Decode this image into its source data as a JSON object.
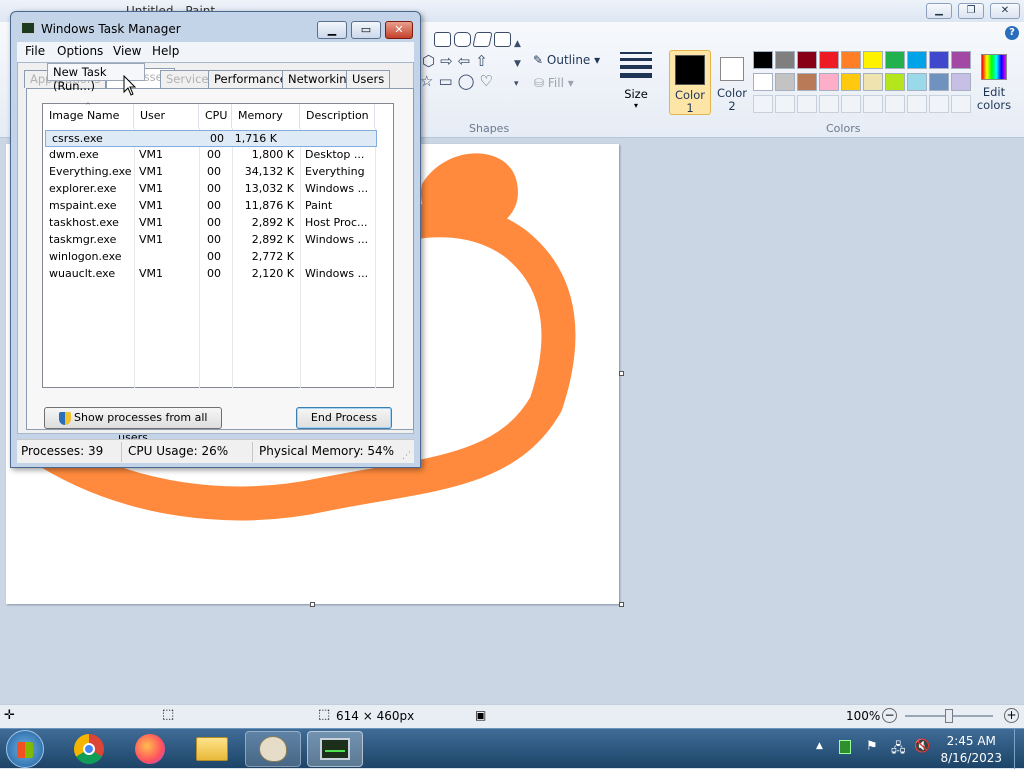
{
  "paint": {
    "title": "Untitled - Paint",
    "ribbon": {
      "outline_label": "Outline",
      "fill_label": "Fill",
      "size_label": "Size",
      "color1_label_line1": "Color",
      "color1_label_line2": "1",
      "color2_label_line1": "Color",
      "color2_label_line2": "2",
      "edit_colors_line1": "Edit",
      "edit_colors_line2": "colors",
      "shapes_group": "Shapes",
      "colors_group": "Colors"
    },
    "palette": [
      "#000000",
      "#7f7f7f",
      "#880015",
      "#ed1c24",
      "#ff7f27",
      "#fff200",
      "#22b14c",
      "#00a2e8",
      "#3f48cc",
      "#a349a4",
      "#ffffff",
      "#c3c3c3",
      "#b97a57",
      "#ffaec9",
      "#ffc90e",
      "#efe4b0",
      "#b5e61d",
      "#99d9ea",
      "#7092be",
      "#c8bfe7"
    ],
    "brush_color": "#ff8a3d",
    "statusbar": {
      "dimensions": "614 × 460px",
      "zoom": "100%"
    }
  },
  "taskmgr": {
    "title": "Windows Task Manager",
    "menu": [
      "File",
      "Options",
      "View",
      "Help"
    ],
    "tabs": {
      "applications": "Applications",
      "processes": "Processes",
      "services": "Services",
      "performance": "Performance",
      "networking": "Networking",
      "users": "Users"
    },
    "tooltip": "New Task (Run...)",
    "columns": [
      "Image Name",
      "User Name",
      "CPU",
      "Memory (...",
      "Description"
    ],
    "processes": [
      {
        "name": "csrss.exe",
        "user": "",
        "cpu": "00",
        "mem": "1,716 K",
        "desc": ""
      },
      {
        "name": "dwm.exe",
        "user": "VM1",
        "cpu": "00",
        "mem": "1,800 K",
        "desc": "Desktop ..."
      },
      {
        "name": "Everything.exe",
        "user": "VM1",
        "cpu": "00",
        "mem": "34,132 K",
        "desc": "Everything"
      },
      {
        "name": "explorer.exe",
        "user": "VM1",
        "cpu": "00",
        "mem": "13,032 K",
        "desc": "Windows ..."
      },
      {
        "name": "mspaint.exe",
        "user": "VM1",
        "cpu": "00",
        "mem": "11,876 K",
        "desc": "Paint"
      },
      {
        "name": "taskhost.exe",
        "user": "VM1",
        "cpu": "00",
        "mem": "2,892 K",
        "desc": "Host Proc..."
      },
      {
        "name": "taskmgr.exe",
        "user": "VM1",
        "cpu": "00",
        "mem": "2,892 K",
        "desc": "Windows ..."
      },
      {
        "name": "winlogon.exe",
        "user": "",
        "cpu": "00",
        "mem": "2,772 K",
        "desc": ""
      },
      {
        "name": "wuauclt.exe",
        "user": "VM1",
        "cpu": "00",
        "mem": "2,120 K",
        "desc": "Windows ..."
      }
    ],
    "show_all_label": "Show processes from all users",
    "end_process_label": "End Process",
    "status": {
      "processes": "Processes: 39",
      "cpu": "CPU Usage: 26%",
      "memory": "Physical Memory: 54%"
    }
  },
  "taskbar": {
    "time": "2:45 AM",
    "date": "8/16/2023"
  }
}
